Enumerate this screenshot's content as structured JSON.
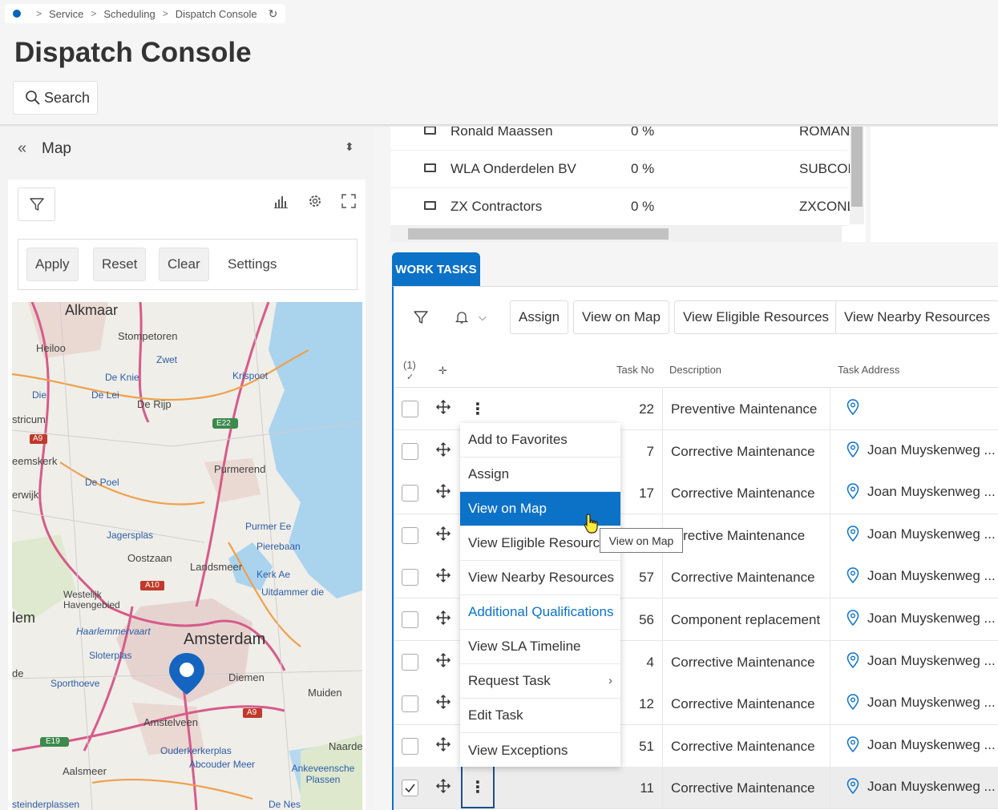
{
  "breadcrumb": {
    "items": [
      "Service",
      "Scheduling",
      "Dispatch Console"
    ]
  },
  "page_title": "Dispatch Console",
  "search_label": "Search",
  "left_panel": {
    "title": "Map",
    "apply_label": "Apply",
    "reset_label": "Reset",
    "clear_label": "Clear",
    "settings_label": "Settings",
    "map_labels": [
      "Alkmaar",
      "Heiloo",
      "Stompetoren",
      "Zwet",
      "Krispoot",
      "De Knie",
      "Die",
      "De Lei",
      "De Rijp",
      "stricum",
      "A9",
      "E22",
      "eemskerk",
      "Purmerend",
      "De Poel",
      "erwijk",
      "Jagersplas",
      "Purmer Ee",
      "Pierebaan",
      "Oostzaan",
      "Landsmeer",
      "Kerk Ae",
      "Uitdammer die",
      "Westelijk Havengebied",
      "A10",
      "lem",
      "Haarlemmervaart",
      "Amsterdam",
      "Sloterplas",
      "de",
      "Diemen",
      "Sporthoeve",
      "Muiden",
      "A9",
      "Amstelveen",
      "E19",
      "Naarde",
      "Ouderkerkerplas",
      "Abcouder Meer",
      "Ankeveensche Plassen",
      "Aalsmeer",
      "De Nes",
      "steinderplassen"
    ]
  },
  "resources": [
    {
      "name": "Ronald Maassen",
      "pct": "0 %",
      "code": "ROMAN"
    },
    {
      "name": "WLA Onderdelen BV",
      "pct": "0 %",
      "code": "SUBCON"
    },
    {
      "name": "ZX Contractors",
      "pct": "0 %",
      "code": "ZXCONL"
    }
  ],
  "work_tasks": {
    "tab_label": "WORK TASKS",
    "toolbar": {
      "assign": "Assign",
      "view_on_map": "View on Map",
      "view_eligible": "View Eligible Resources",
      "view_nearby": "View Nearby Resources"
    },
    "selected_count": "(1)",
    "columns": {
      "task_no": "Task No",
      "description": "Description",
      "task_address": "Task Address"
    },
    "rows": [
      {
        "task_no": "22",
        "description": "Preventive Maintenance",
        "address": "",
        "checked": false
      },
      {
        "task_no": "7",
        "description": "Corrective Maintenance",
        "address": "Joan Muyskenweg ...",
        "checked": false
      },
      {
        "task_no": "17",
        "description": "Corrective Maintenance",
        "address": "Joan Muyskenweg ...",
        "checked": false
      },
      {
        "task_no": "",
        "description": "orrective Maintenance",
        "address": "Joan Muyskenweg ...",
        "checked": false
      },
      {
        "task_no": "57",
        "description": "Corrective Maintenance",
        "address": "Joan Muyskenweg ...",
        "checked": false
      },
      {
        "task_no": "56",
        "description": "Component replacement",
        "address": "Joan Muyskenweg ...",
        "checked": false
      },
      {
        "task_no": "4",
        "description": "Corrective Maintenance",
        "address": "Joan Muyskenweg ...",
        "checked": false
      },
      {
        "task_no": "12",
        "description": "Corrective Maintenance",
        "address": "Joan Muyskenweg ...",
        "checked": false
      },
      {
        "task_no": "51",
        "description": "Corrective Maintenance",
        "address": "Joan Muyskenweg ...",
        "checked": false
      },
      {
        "task_no": "11",
        "description": "Corrective Maintenance",
        "address": "Joan Muyskenweg ...",
        "checked": true
      }
    ]
  },
  "context_menu": {
    "items": [
      "Add to Favorites",
      "Assign",
      "View on Map",
      "View Eligible Resources",
      "View Nearby Resources",
      "Additional Qualifications",
      "View SLA Timeline",
      "Request Task",
      "Edit Task",
      "View Exceptions"
    ],
    "active_item": "View on Map"
  },
  "tooltip": "View on Map",
  "colors": {
    "accent": "#0c72c8",
    "pin": "#1565c0"
  }
}
